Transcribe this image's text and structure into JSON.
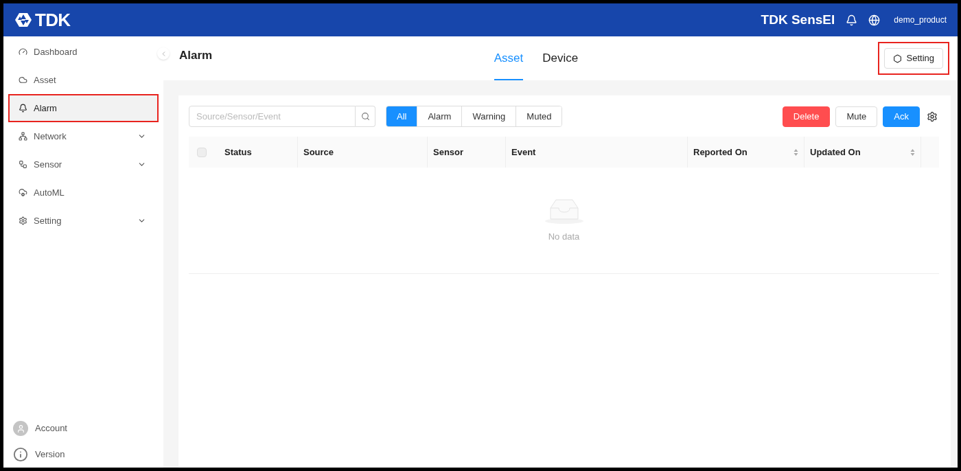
{
  "header": {
    "logo": "TDK",
    "product": "TDK SensEI",
    "user": "demo_product"
  },
  "sidebar": {
    "items": [
      {
        "label": "Dashboard",
        "selected": false,
        "expandable": false,
        "highlighted": false
      },
      {
        "label": "Asset",
        "selected": false,
        "expandable": false,
        "highlighted": false
      },
      {
        "label": "Alarm",
        "selected": true,
        "expandable": false,
        "highlighted": true
      },
      {
        "label": "Network",
        "selected": false,
        "expandable": true,
        "highlighted": false
      },
      {
        "label": "Sensor",
        "selected": false,
        "expandable": true,
        "highlighted": false
      },
      {
        "label": "AutoML",
        "selected": false,
        "expandable": false,
        "highlighted": false
      },
      {
        "label": "Setting",
        "selected": false,
        "expandable": true,
        "highlighted": false
      }
    ],
    "footer": [
      {
        "label": "Account"
      },
      {
        "label": "Version"
      }
    ]
  },
  "page": {
    "title": "Alarm",
    "tabs": [
      {
        "label": "Asset",
        "selected": true
      },
      {
        "label": "Device",
        "selected": false
      }
    ],
    "setting_button": {
      "label": "Setting",
      "highlighted": true
    }
  },
  "toolbar": {
    "search": {
      "placeholder": "Source/Sensor/Event"
    },
    "filters": [
      {
        "label": "All",
        "selected": true
      },
      {
        "label": "Alarm",
        "selected": false
      },
      {
        "label": "Warning",
        "selected": false
      },
      {
        "label": "Muted",
        "selected": false
      }
    ],
    "actions": [
      {
        "label": "Delete",
        "kind": "danger"
      },
      {
        "label": "Mute",
        "kind": "default"
      },
      {
        "label": "Ack",
        "kind": "primary"
      }
    ]
  },
  "table": {
    "select_all": {
      "checked": false
    },
    "columns": [
      {
        "label": "Status",
        "sortable": false
      },
      {
        "label": "Source",
        "sortable": false
      },
      {
        "label": "Sensor",
        "sortable": false
      },
      {
        "label": "Event",
        "sortable": false
      },
      {
        "label": "Reported On",
        "sortable": true
      },
      {
        "label": "Updated On",
        "sortable": true
      }
    ],
    "empty_text": "No data"
  }
}
